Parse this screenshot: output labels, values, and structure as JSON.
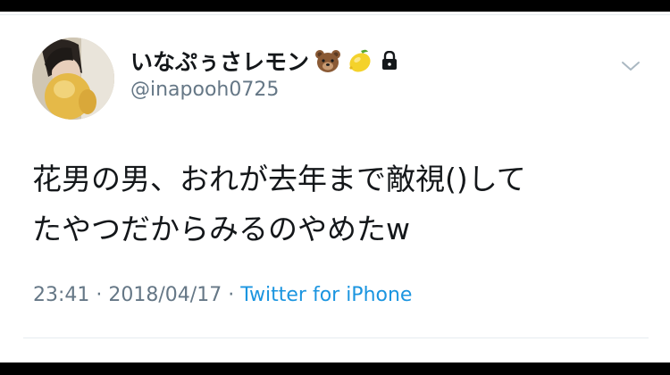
{
  "user": {
    "display_name": "いなぷぅさレモン",
    "handle": "@inapooh0725",
    "emojis": [
      "bear-icon",
      "lemon-icon",
      "lock-icon"
    ]
  },
  "tweet": {
    "text": "花男の男、おれが去年まで敵視()して\nたやつだからみるのやめたw",
    "time": "23:41",
    "separator": "·",
    "date": "2018/04/17",
    "source": "Twitter for iPhone"
  },
  "colors": {
    "text": "#14171a",
    "secondary": "#657786",
    "link": "#1b95e0",
    "divider": "#e6ecf0"
  }
}
